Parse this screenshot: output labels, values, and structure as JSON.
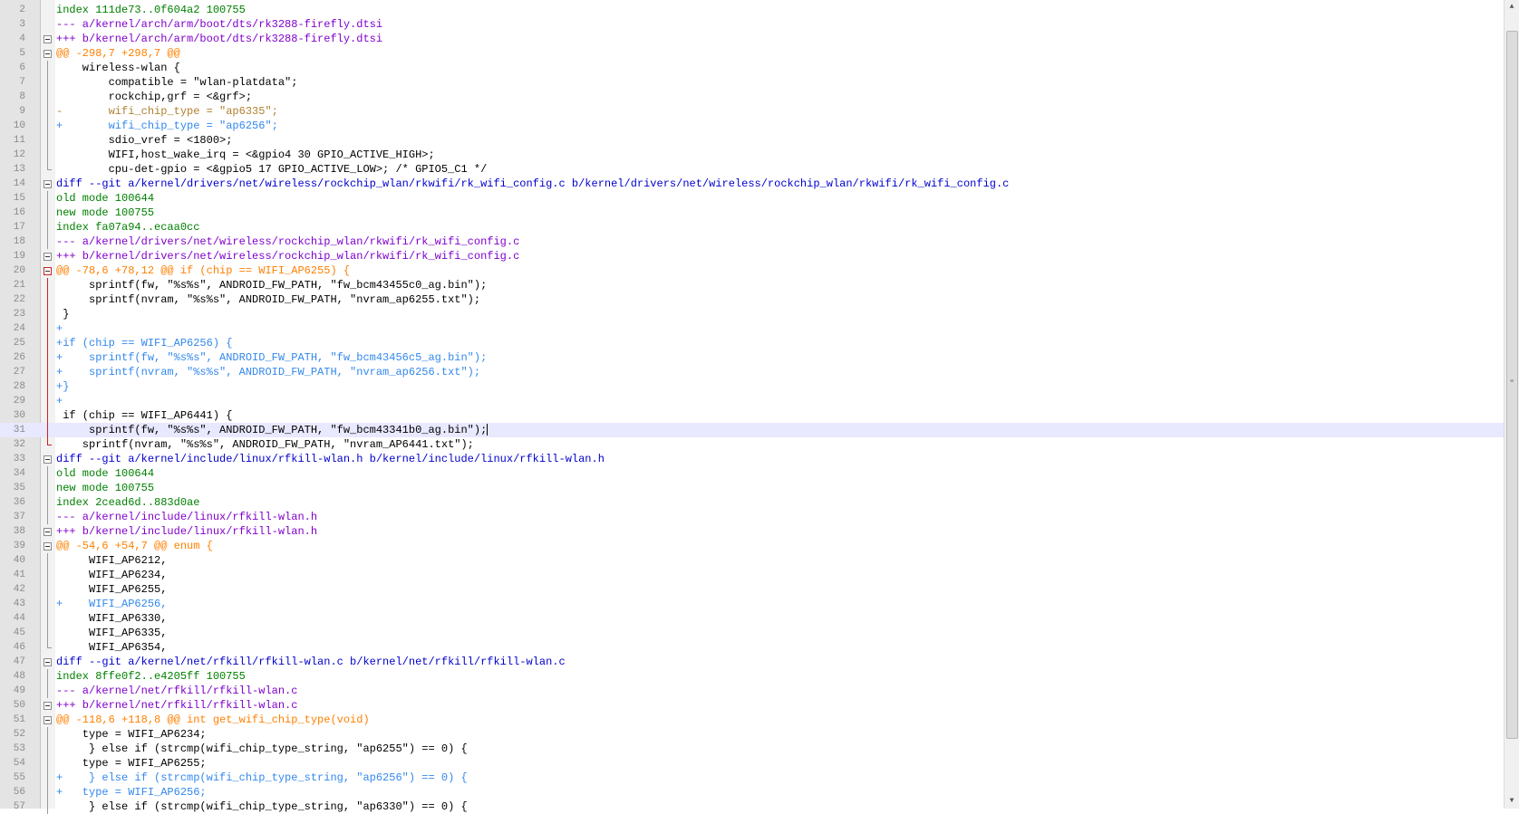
{
  "editor": {
    "lines": [
      {
        "n": "2",
        "t": "index 111de73..0f604a2 100755",
        "k": "meta"
      },
      {
        "n": "3",
        "t": "--- a/kernel/arch/arm/boot/dts/rk3288-firefly.dtsi",
        "k": "file"
      },
      {
        "n": "4",
        "t": "+++ b/kernel/arch/arm/boot/dts/rk3288-firefly.dtsi",
        "k": "file"
      },
      {
        "n": "5",
        "t": "@@ -298,7 +298,7 @@",
        "k": "hunk"
      },
      {
        "n": "6",
        "t": "    wireless-wlan {",
        "k": "ctx"
      },
      {
        "n": "7",
        "t": "        compatible = \"wlan-platdata\";",
        "k": "ctx"
      },
      {
        "n": "8",
        "t": "        rockchip,grf = <&grf>;",
        "k": "ctx"
      },
      {
        "n": "9",
        "t": "-       wifi_chip_type = \"ap6335\";",
        "k": "del"
      },
      {
        "n": "10",
        "t": "+       wifi_chip_type = \"ap6256\";",
        "k": "add"
      },
      {
        "n": "11",
        "t": "        sdio_vref = <1800>;",
        "k": "ctx"
      },
      {
        "n": "12",
        "t": "        WIFI,host_wake_irq = <&gpio4 30 GPIO_ACTIVE_HIGH>;",
        "k": "ctx"
      },
      {
        "n": "13",
        "t": "        cpu-det-gpio = <&gpio5 17 GPIO_ACTIVE_LOW>; /* GPIO5_C1 */",
        "k": "ctx"
      },
      {
        "n": "14",
        "t": "diff --git a/kernel/drivers/net/wireless/rockchip_wlan/rkwifi/rk_wifi_config.c b/kernel/drivers/net/wireless/rockchip_wlan/rkwifi/rk_wifi_config.c",
        "k": "header"
      },
      {
        "n": "15",
        "t": "old mode 100644",
        "k": "meta"
      },
      {
        "n": "16",
        "t": "new mode 100755",
        "k": "meta"
      },
      {
        "n": "17",
        "t": "index fa07a94..ecaa0cc",
        "k": "meta"
      },
      {
        "n": "18",
        "t": "--- a/kernel/drivers/net/wireless/rockchip_wlan/rkwifi/rk_wifi_config.c",
        "k": "file"
      },
      {
        "n": "19",
        "t": "+++ b/kernel/drivers/net/wireless/rockchip_wlan/rkwifi/rk_wifi_config.c",
        "k": "file"
      },
      {
        "n": "20",
        "t": "@@ -78,6 +78,12 @@ if (chip == WIFI_AP6255) {",
        "k": "hunk"
      },
      {
        "n": "21",
        "t": "     sprintf(fw, \"%s%s\", ANDROID_FW_PATH, \"fw_bcm43455c0_ag.bin\");",
        "k": "ctx"
      },
      {
        "n": "22",
        "t": "     sprintf(nvram, \"%s%s\", ANDROID_FW_PATH, \"nvram_ap6255.txt\");",
        "k": "ctx"
      },
      {
        "n": "23",
        "t": " }",
        "k": "ctx"
      },
      {
        "n": "24",
        "t": "+",
        "k": "add"
      },
      {
        "n": "25",
        "t": "+if (chip == WIFI_AP6256) {",
        "k": "add"
      },
      {
        "n": "26",
        "t": "+    sprintf(fw, \"%s%s\", ANDROID_FW_PATH, \"fw_bcm43456c5_ag.bin\");",
        "k": "add"
      },
      {
        "n": "27",
        "t": "+    sprintf(nvram, \"%s%s\", ANDROID_FW_PATH, \"nvram_ap6256.txt\");",
        "k": "add"
      },
      {
        "n": "28",
        "t": "+}",
        "k": "add"
      },
      {
        "n": "29",
        "t": "+",
        "k": "add"
      },
      {
        "n": "30",
        "t": " if (chip == WIFI_AP6441) {",
        "k": "ctx"
      },
      {
        "n": "31",
        "t": "     sprintf(fw, \"%s%s\", ANDROID_FW_PATH, \"fw_bcm43341b0_ag.bin\");",
        "k": "ctx"
      },
      {
        "n": "32",
        "t": "    sprintf(nvram, \"%s%s\", ANDROID_FW_PATH, \"nvram_AP6441.txt\");",
        "k": "ctx"
      },
      {
        "n": "33",
        "t": "diff --git a/kernel/include/linux/rfkill-wlan.h b/kernel/include/linux/rfkill-wlan.h",
        "k": "header"
      },
      {
        "n": "34",
        "t": "old mode 100644",
        "k": "meta"
      },
      {
        "n": "35",
        "t": "new mode 100755",
        "k": "meta"
      },
      {
        "n": "36",
        "t": "index 2cead6d..883d0ae",
        "k": "meta"
      },
      {
        "n": "37",
        "t": "--- a/kernel/include/linux/rfkill-wlan.h",
        "k": "file"
      },
      {
        "n": "38",
        "t": "+++ b/kernel/include/linux/rfkill-wlan.h",
        "k": "file"
      },
      {
        "n": "39",
        "t": "@@ -54,6 +54,7 @@ enum {",
        "k": "hunk"
      },
      {
        "n": "40",
        "t": "     WIFI_AP6212,",
        "k": "ctx"
      },
      {
        "n": "41",
        "t": "     WIFI_AP6234,",
        "k": "ctx"
      },
      {
        "n": "42",
        "t": "     WIFI_AP6255,",
        "k": "ctx"
      },
      {
        "n": "43",
        "t": "+    WIFI_AP6256,",
        "k": "add"
      },
      {
        "n": "44",
        "t": "     WIFI_AP6330,",
        "k": "ctx"
      },
      {
        "n": "45",
        "t": "     WIFI_AP6335,",
        "k": "ctx"
      },
      {
        "n": "46",
        "t": "     WIFI_AP6354,",
        "k": "ctx"
      },
      {
        "n": "47",
        "t": "diff --git a/kernel/net/rfkill/rfkill-wlan.c b/kernel/net/rfkill/rfkill-wlan.c",
        "k": "header"
      },
      {
        "n": "48",
        "t": "index 8ffe0f2..e4205ff 100755",
        "k": "meta"
      },
      {
        "n": "49",
        "t": "--- a/kernel/net/rfkill/rfkill-wlan.c",
        "k": "file"
      },
      {
        "n": "50",
        "t": "+++ b/kernel/net/rfkill/rfkill-wlan.c",
        "k": "file"
      },
      {
        "n": "51",
        "t": "@@ -118,6 +118,8 @@ int get_wifi_chip_type(void)",
        "k": "hunk"
      },
      {
        "n": "52",
        "t": "    type = WIFI_AP6234;",
        "k": "ctx"
      },
      {
        "n": "53",
        "t": "     } else if (strcmp(wifi_chip_type_string, \"ap6255\") == 0) {",
        "k": "ctx"
      },
      {
        "n": "54",
        "t": "    type = WIFI_AP6255;",
        "k": "ctx"
      },
      {
        "n": "55",
        "t": "+    } else if (strcmp(wifi_chip_type_string, \"ap6256\") == 0) {",
        "k": "add"
      },
      {
        "n": "56",
        "t": "+   type = WIFI_AP6256;",
        "k": "add"
      },
      {
        "n": "57",
        "t": "     } else if (strcmp(wifi_chip_type_string, \"ap6330\") == 0) {",
        "k": "ctx"
      }
    ],
    "current_line": "31"
  },
  "colors": {
    "meta": "#008000",
    "header": "#0000cc",
    "file": "#8000cc",
    "hunk": "#ff8000",
    "context": "#000000",
    "added": "#3388ee",
    "removed": "#b08030",
    "current_line_highlight": "#e8e8ff"
  },
  "icons": [
    "fold-minus-icon",
    "fold-line-icon",
    "scroll-up-arrow-icon",
    "scroll-down-arrow-icon",
    "scroll-grip-icon"
  ]
}
